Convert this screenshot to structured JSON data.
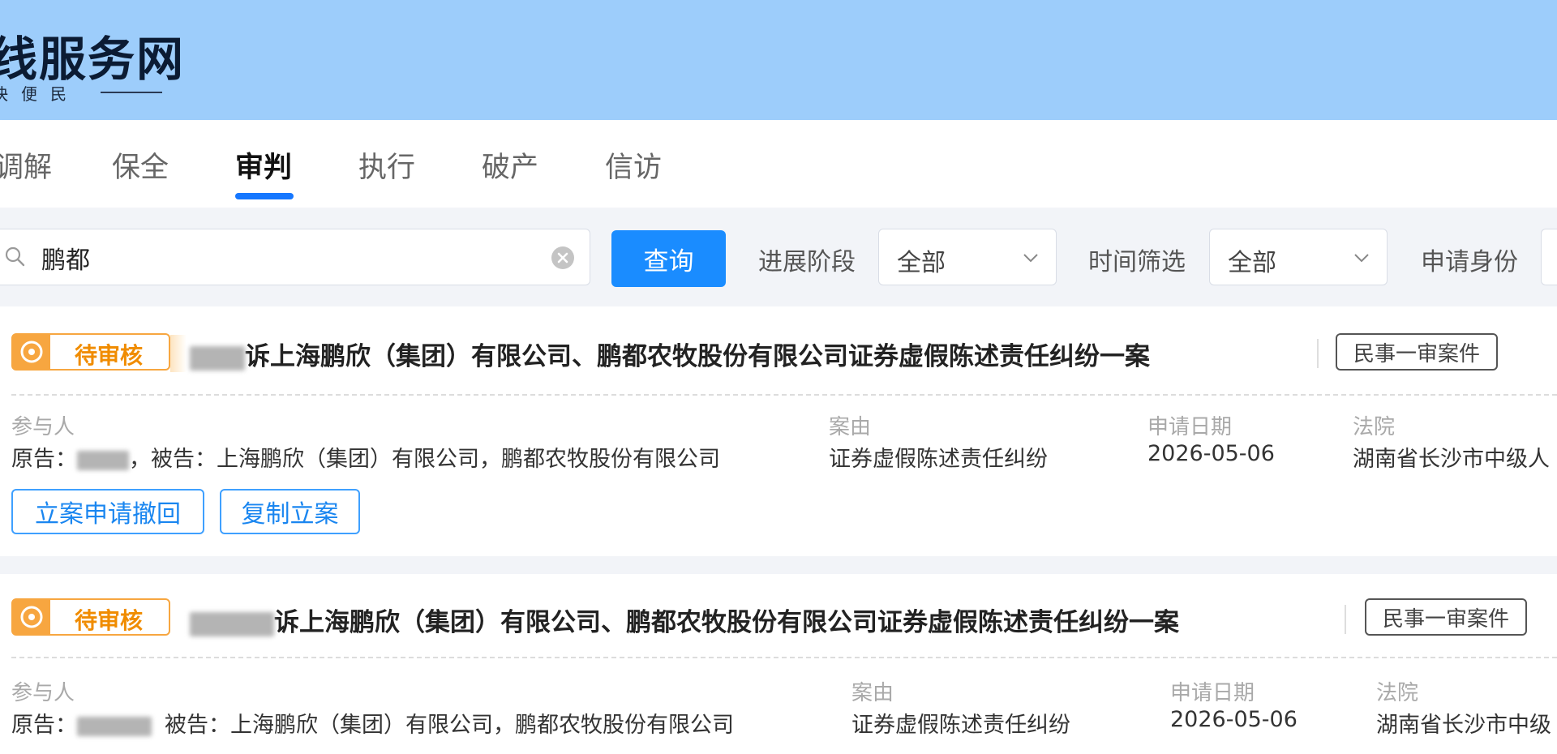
{
  "header": {
    "logo_title": "线服务网",
    "logo_sub": "快便民"
  },
  "nav": {
    "tabs": [
      "调解",
      "保全",
      "审判",
      "执行",
      "破产",
      "信访"
    ],
    "active": "审判"
  },
  "filter": {
    "search_value": "鹏都",
    "query_label": "查询",
    "progress_label": "进展阶段",
    "progress_value": "全部",
    "time_label": "时间筛选",
    "time_value": "全部",
    "identity_label": "申请身份"
  },
  "labels": {
    "participants": "参与人",
    "cause": "案由",
    "apply_date": "申请日期",
    "court": "法院"
  },
  "cases": [
    {
      "status": "待审核",
      "title": "诉上海鹏欣（集团）有限公司、鹏都农牧股份有限公司证券虚假陈述责任纠纷一案",
      "type": "民事一审案件",
      "plaintiff_prefix": "原告：",
      "defendant_text": "，被告：上海鹏欣（集团）有限公司，鹏都农牧股份有限公司",
      "cause": "证券虚假陈述责任纠纷",
      "date": "2026-05-06",
      "court": "湖南省长沙市中级人",
      "actions": [
        "立案申请撤回",
        "复制立案"
      ]
    },
    {
      "status": "待审核",
      "title": "诉上海鹏欣（集团）有限公司、鹏都农牧股份有限公司证券虚假陈述责任纠纷一案",
      "type": "民事一审案件",
      "plaintiff_prefix": "原告：",
      "defendant_text": "被告：上海鹏欣（集团）有限公司，鹏都农牧股份有限公司",
      "cause": "证券虚假陈述责任纠纷",
      "date": "2026-05-06",
      "court": "湖南省长沙市中级"
    }
  ]
}
